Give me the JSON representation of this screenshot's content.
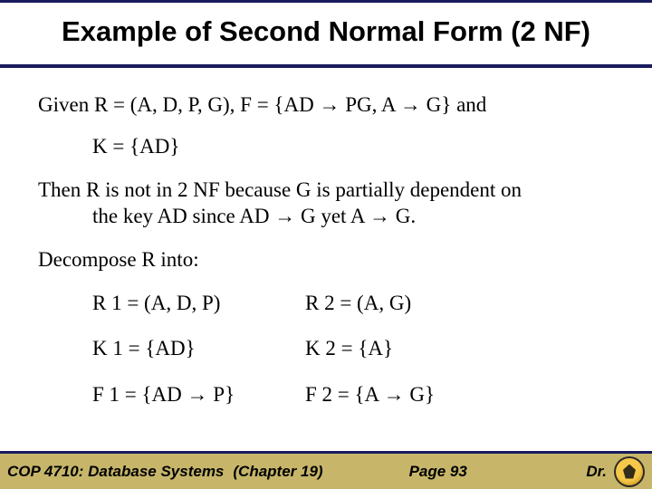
{
  "title": "Example of Second Normal Form (2 NF)",
  "given_pre": "Given R = (A, D, P, G), F = {AD ",
  "given_mid1": " PG, A ",
  "given_post": " G} and",
  "key_line": "K = {AD}",
  "then_line1": "Then R is not in 2 NF because G is partially dependent on",
  "then_line2_a": "the key AD since AD ",
  "then_line2_b": " G yet A ",
  "then_line2_c": " G.",
  "decompose": "Decompose R into:",
  "table": {
    "r1": "R 1 = (A, D, P)",
    "r2": "R 2 = (A, G)",
    "k1": "K 1 = {AD}",
    "k2": "K 2 = {A}",
    "f1_a": "F 1 = {AD ",
    "f1_b": " P}",
    "f2_a": "F 2 = {A ",
    "f2_b": " G}"
  },
  "footer": {
    "course": "COP 4710: Database Systems",
    "chapter": "(Chapter 19)",
    "page": "Page 93",
    "author": "Dr."
  },
  "arrow": "→"
}
